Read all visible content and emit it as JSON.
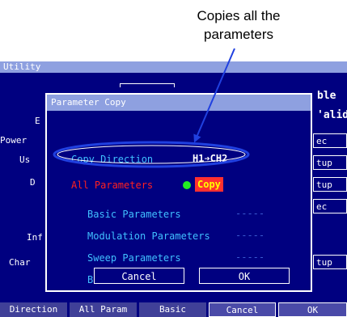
{
  "callout": {
    "line1": "Copies all the",
    "line2": "parameters"
  },
  "window": {
    "title": "Utility"
  },
  "background": {
    "left_labels": [
      "E",
      "Power",
      "Us",
      "D",
      "Inf",
      "Char"
    ],
    "right_header_1": "ble",
    "right_header_2": "'alid",
    "right_boxes": [
      "ec",
      "tup",
      "tup",
      "ec",
      "tup"
    ]
  },
  "dialog": {
    "title": "Parameter Copy",
    "copy_direction": {
      "label": "Copy Direction",
      "value": "H1➔CH2"
    },
    "all_parameters": {
      "label": "All Parameters",
      "value": "Copy"
    },
    "params": [
      {
        "label": "Basic Parameters",
        "value": "-----"
      },
      {
        "label": "Modulation Parameters",
        "value": "-----"
      },
      {
        "label": "Sweep Parameters",
        "value": "-----"
      },
      {
        "label": "Burst Parameters",
        "value": "-----"
      }
    ],
    "cancel_label": "Cancel",
    "ok_label": "OK"
  },
  "softkeys": [
    "Direction",
    "All Param",
    "Basic",
    "Cancel",
    "OK"
  ],
  "colors": {
    "screen_bg": "#000080",
    "title_bar": "#8ea0e0",
    "label_cyan": "#40c0ff",
    "highlight_red": "#ff2020",
    "indicator_green": "#22ee22",
    "ellipse_blue": "#2040e0"
  },
  "icons": {
    "indicator": "green-dot-icon",
    "arrow": "right-arrow-icon"
  }
}
